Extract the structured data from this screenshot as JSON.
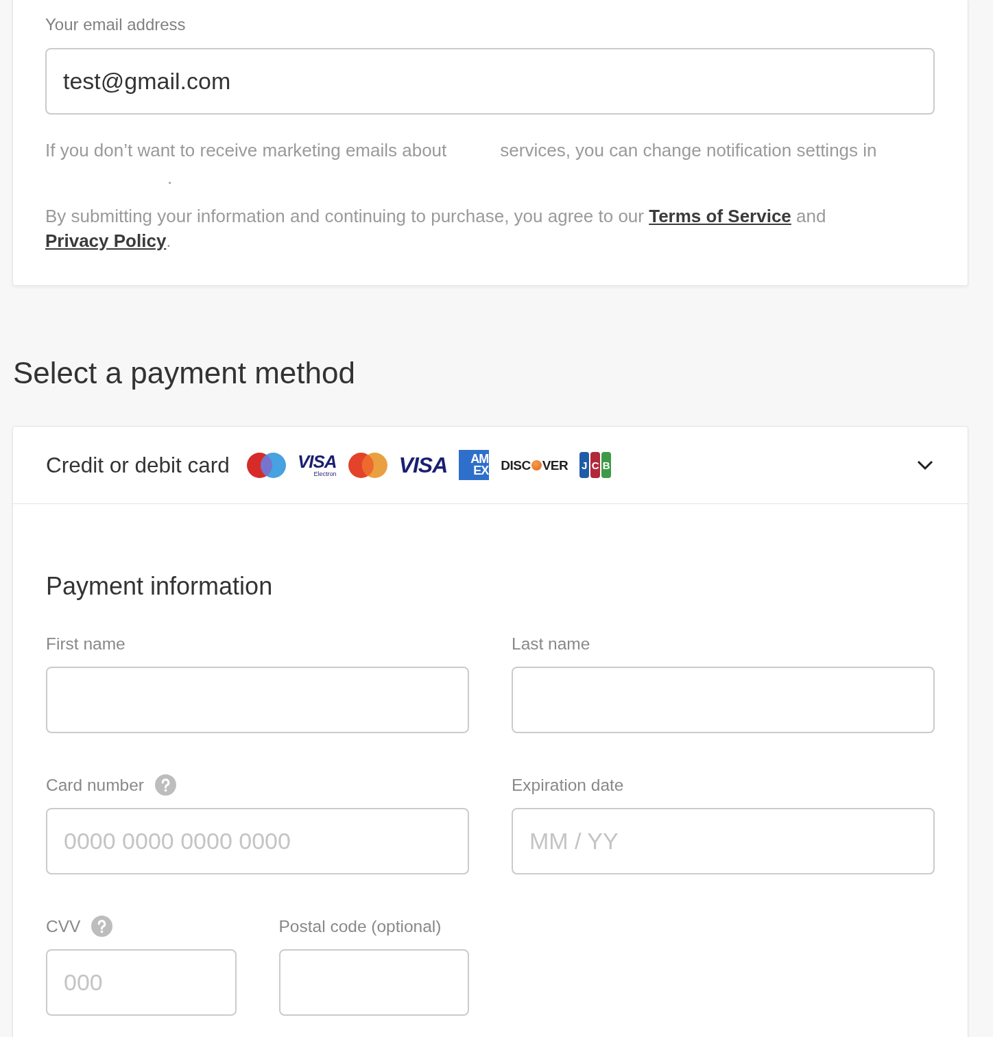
{
  "email_section": {
    "label": "Your email address",
    "value": "test@gmail.com",
    "marketing_note": [
      "If you don’t want to receive marketing emails about",
      "services, you can change notification settings in",
      "."
    ],
    "terms": {
      "before": "By submitting your information and continuing to purchase, you agree to our",
      "link_1": "Terms of Service",
      "between": "and",
      "link_2": "Privacy Policy",
      "after": "."
    }
  },
  "payment": {
    "heading": "Select a payment method",
    "method": {
      "label": "Credit or debit card",
      "expanded": true,
      "logos": [
        {
          "kind": "maestro"
        },
        {
          "kind": "visa_electron",
          "text": "VISA",
          "subtext": "Electron"
        },
        {
          "kind": "mastercard"
        },
        {
          "kind": "visa",
          "text": "VISA"
        },
        {
          "kind": "amex",
          "lines": [
            "AM",
            "EX"
          ]
        },
        {
          "kind": "discover",
          "parts": [
            "DISC",
            "VER"
          ]
        },
        {
          "kind": "jcb",
          "letters": [
            "J",
            "C",
            "B"
          ]
        }
      ]
    },
    "form": {
      "title": "Payment information",
      "rows": [
        [
          {
            "label": "First name",
            "help": false
          },
          {
            "label": "Last name",
            "help": false
          }
        ],
        [
          {
            "label": "Card number",
            "help": true,
            "placeholder": "0000 0000 0000 0000"
          },
          {
            "label": "Expiration date",
            "help": false,
            "placeholder": "MM / YY"
          }
        ],
        [
          {
            "group": [
              {
                "label": "CVV",
                "help": true,
                "placeholder": "000"
              },
              {
                "label": "Postal code (optional)",
                "help": false
              }
            ]
          }
        ]
      ]
    }
  }
}
